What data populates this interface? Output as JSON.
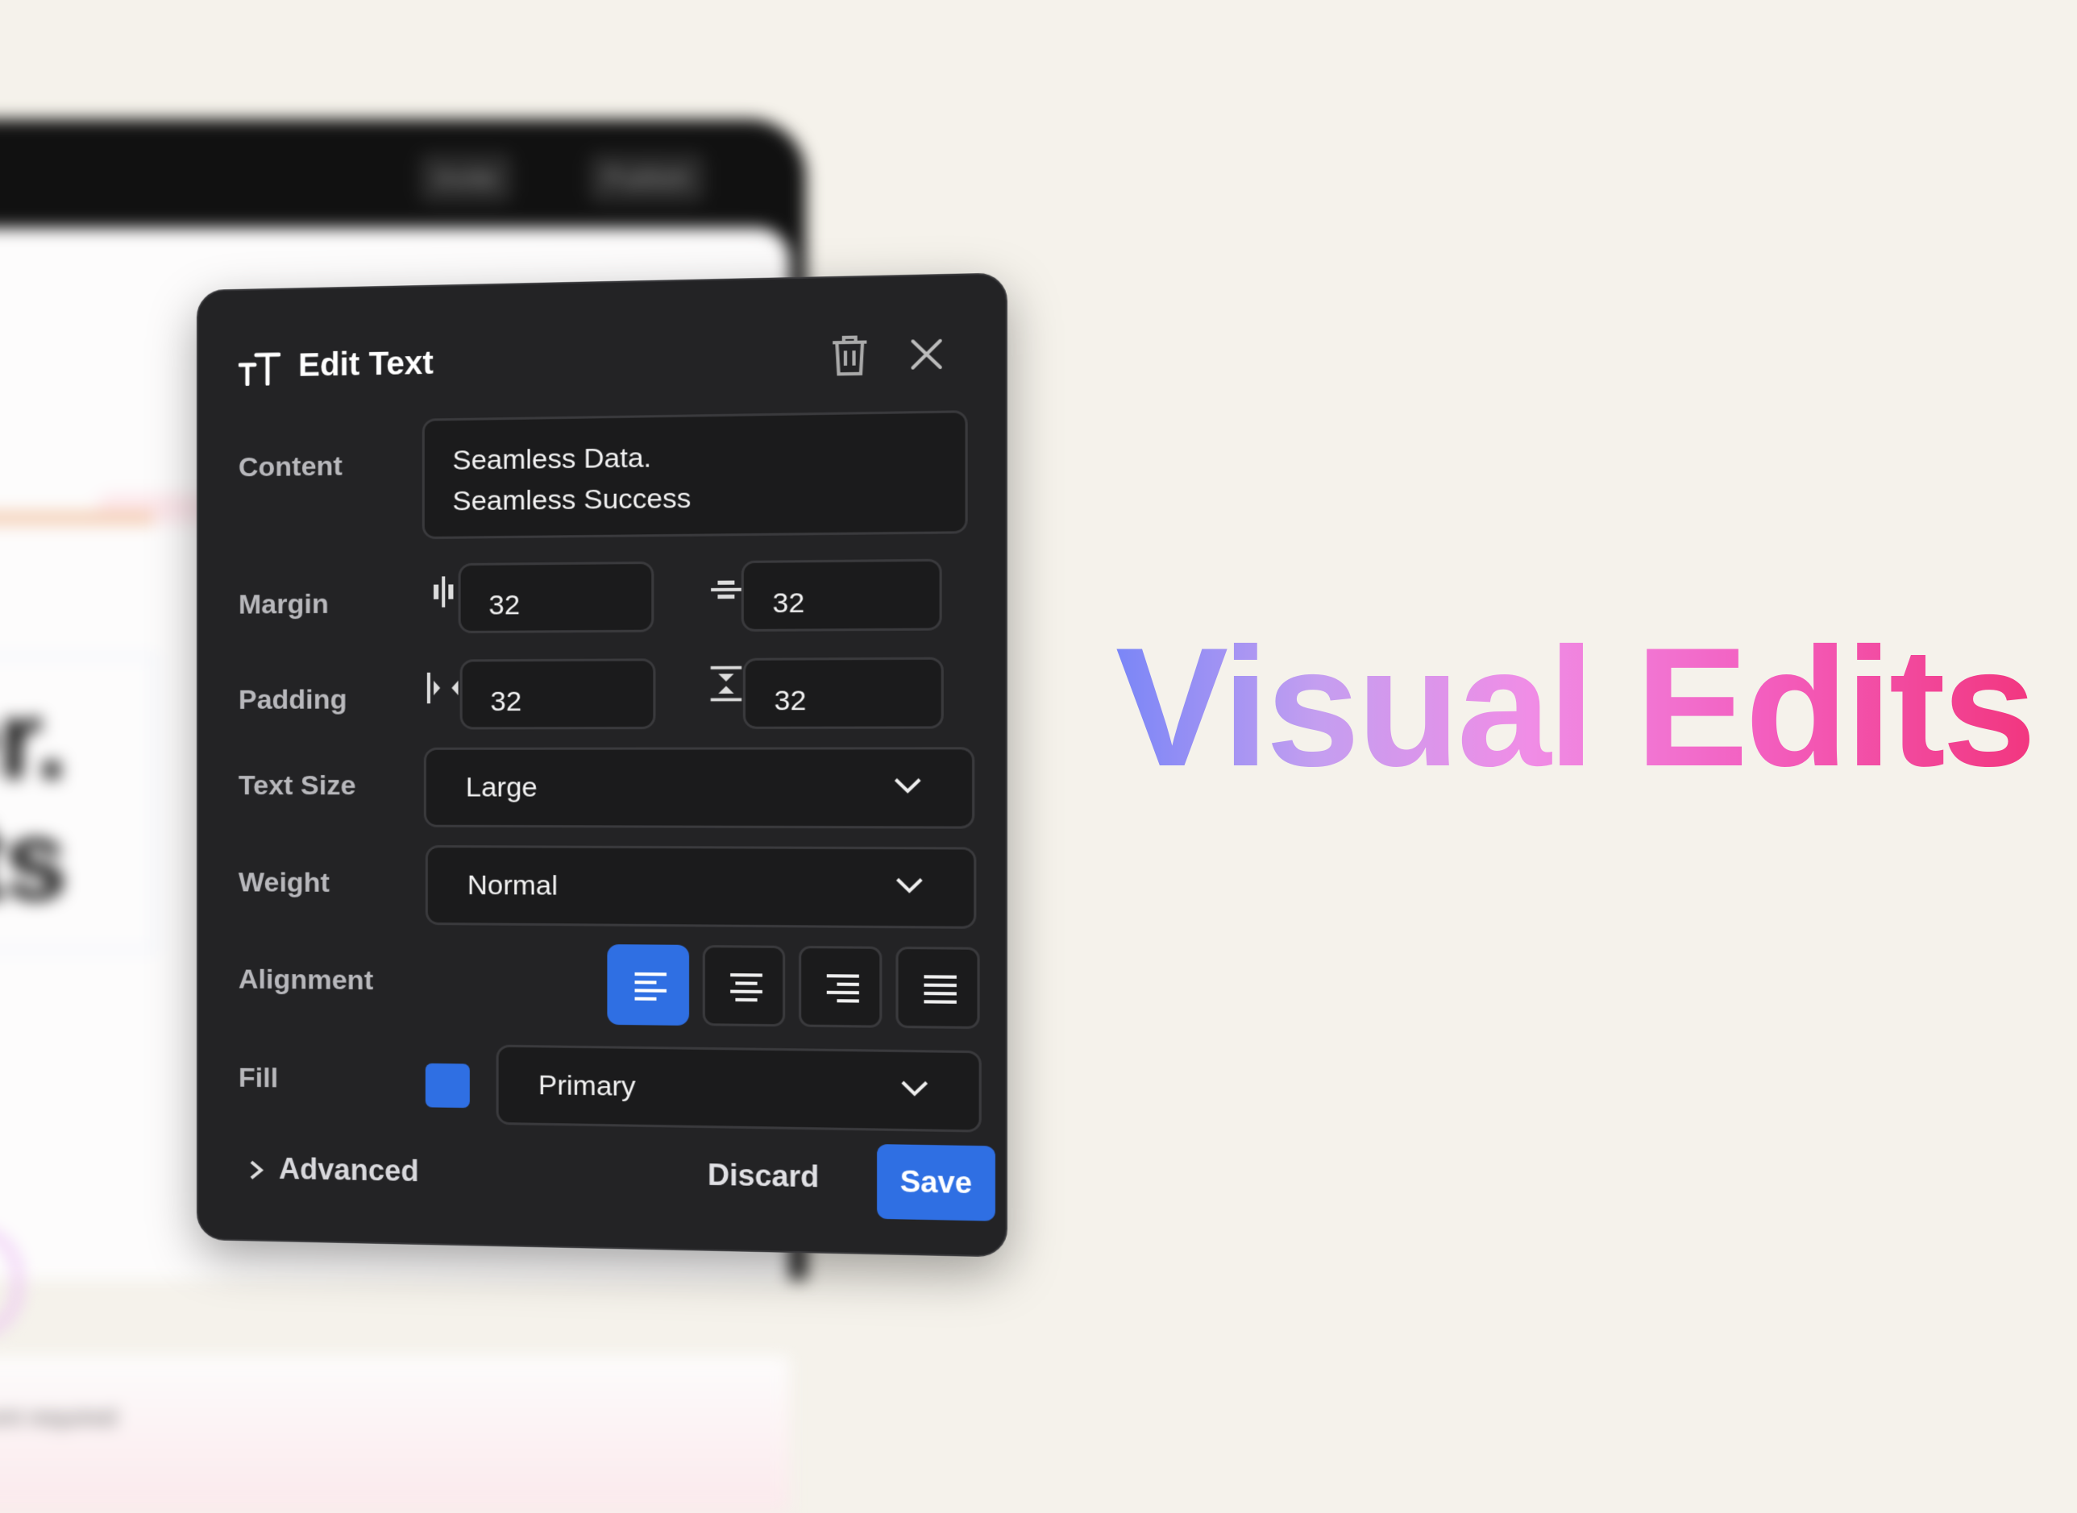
{
  "background_app": {
    "toolbar": [
      "Invite",
      "Publish"
    ],
    "headline_fragment": [
      "er.",
      "lts"
    ],
    "footnote": "...ent required"
  },
  "panel": {
    "title": "Edit Text",
    "content_label": "Content",
    "content_value_line1": "Seamless Data.",
    "content_value_line2": "Seamless Success",
    "margin_label": "Margin",
    "margin_horizontal": "32",
    "margin_vertical": "32",
    "padding_label": "Padding",
    "padding_horizontal": "32",
    "padding_vertical": "32",
    "text_size_label": "Text Size",
    "text_size_value": "Large",
    "weight_label": "Weight",
    "weight_value": "Normal",
    "alignment_label": "Alignment",
    "alignment_options": [
      "left",
      "center",
      "right",
      "justify"
    ],
    "alignment_selected": "left",
    "fill_label": "Fill",
    "fill_value": "Primary",
    "fill_color": "#2f6fe3",
    "advanced_label": "Advanced",
    "discard_label": "Discard",
    "save_label": "Save"
  },
  "headline": "Visual Edits",
  "colors": {
    "accent": "#2f6fe3",
    "panel_bg": "#232325",
    "page_bg": "#f5f2eb",
    "headline_gradient": [
      "#7a86f7",
      "#f08de6",
      "#f2367f"
    ]
  }
}
